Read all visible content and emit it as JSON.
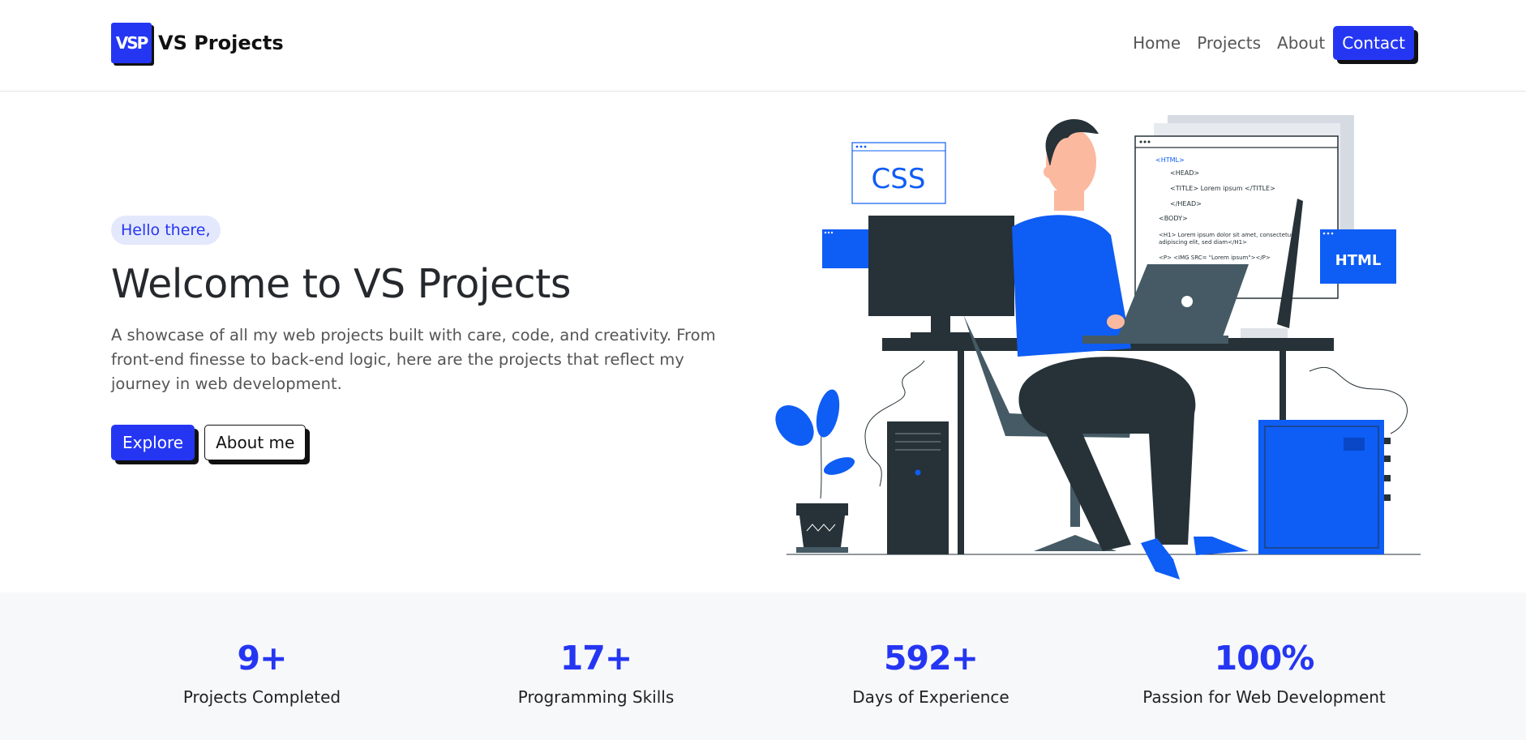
{
  "brand": {
    "logo_text": "VSP",
    "name": "VS Projects"
  },
  "nav": {
    "home": "Home",
    "projects": "Projects",
    "about": "About",
    "contact": "Contact"
  },
  "hero": {
    "badge": "Hello there,",
    "title": "Welcome to VS Projects",
    "description": "A showcase of all my web projects built with care, code, and creativity. From front-end finesse to back-end logic, here are the projects that reflect my journey in web development.",
    "explore_label": "Explore",
    "about_label": "About me"
  },
  "illustration": {
    "css_window_label": "CSS",
    "html_window_label": "HTML",
    "code_lines": [
      "<HTML>",
      "<HEAD>",
      "<TITLE> Lorem ipsum </TITLE>",
      "</HEAD>",
      "<BODY>",
      "<H1> Lorem ipsum dolor sit amet, consectetuer",
      "adipiscing elit, sed diam</H1>",
      "<P> <IMG SRC= \"Lorem ipsum\"></P>"
    ]
  },
  "stats": [
    {
      "value": "9+",
      "label": "Projects Completed"
    },
    {
      "value": "17+",
      "label": "Programming Skills"
    },
    {
      "value": "592+",
      "label": "Days of Experience"
    },
    {
      "value": "100%",
      "label": "Passion for Web Development"
    }
  ],
  "colors": {
    "accent": "#2536f3",
    "illustration_blue": "#0e5df5",
    "dark": "#263238"
  }
}
